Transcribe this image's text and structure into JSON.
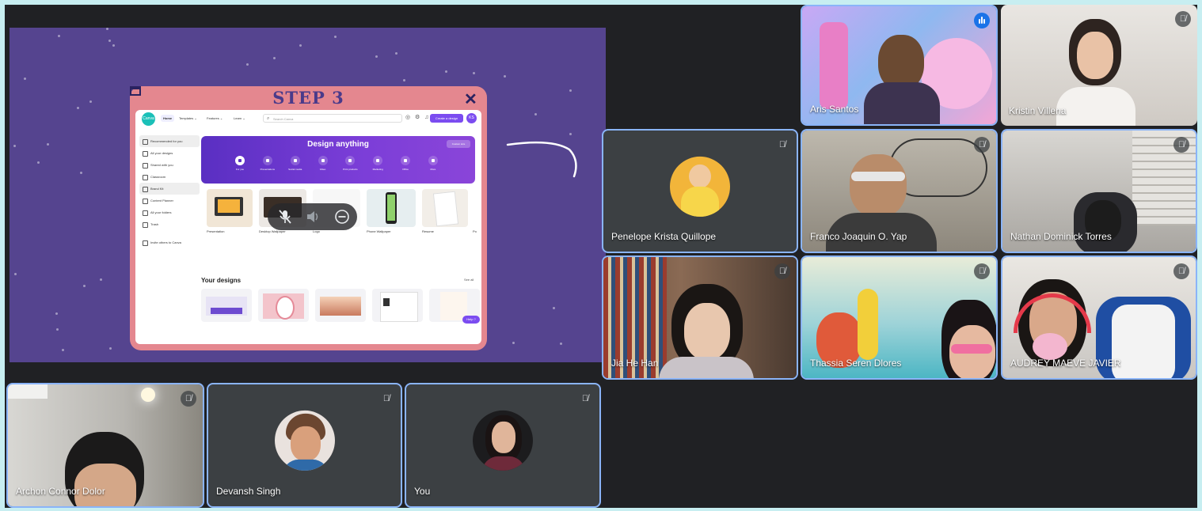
{
  "presentation": {
    "slide_title": "STEP 3",
    "window_max_icon": "maximize-icon",
    "window_close_glyph": "✕",
    "canva": {
      "logo": "Canva",
      "nav": [
        "Home",
        "Templates ⌄",
        "Features ⌄",
        "Learn ⌄"
      ],
      "search_placeholder": "Search Canva",
      "create_button": "Create a design",
      "avatar_initials": "KS",
      "sidebar": [
        "Recommended for you",
        "All your designs",
        "Shared with you",
        "Classroom",
        "Brand Kit",
        "Content Planner",
        "All your folders",
        "Trash",
        "Invite others to Canva"
      ],
      "hero_title": "Design anything",
      "hero_upload": "Custom size",
      "hero_icons": [
        "For you",
        "Presentations",
        "Social media",
        "Video",
        "Print products",
        "Marketing",
        "Office",
        "More"
      ],
      "thumbs": [
        "Presentation",
        "Desktop Wallpaper",
        "Logo",
        "Phone Wallpaper",
        "Resume",
        "Po"
      ],
      "your_designs": "Your designs",
      "see_all": "See all",
      "help": "Help ?"
    }
  },
  "audio_pill": {
    "icons": [
      "mic-off-icon",
      "volume-icon",
      "remove-icon"
    ]
  },
  "participants": [
    {
      "name": "Aris Santos",
      "muted": false,
      "speaking": true
    },
    {
      "name": "Kristin Villena",
      "muted": true
    },
    {
      "name": "Penelope Krista Quillope",
      "muted": true
    },
    {
      "name": "Franco Joaquin O. Yap",
      "muted": true
    },
    {
      "name": "Nathan Dominick Torres",
      "muted": true
    },
    {
      "name": "Jia He Han",
      "muted": true
    },
    {
      "name": "Thassia Seren Dlores",
      "muted": true
    },
    {
      "name": "AUDREY MAEVE JAVIER",
      "muted": true
    },
    {
      "name": "Archon Connor Dolor",
      "muted": true
    },
    {
      "name": "Devansh Singh",
      "muted": true
    },
    {
      "name": "You",
      "muted": true
    }
  ],
  "colors": {
    "page_border": "#c7eef1",
    "meet_background": "#202124",
    "slide_background": "#55448f",
    "speaking_border": "#8ab4f8",
    "accent": "#1a73e8"
  }
}
